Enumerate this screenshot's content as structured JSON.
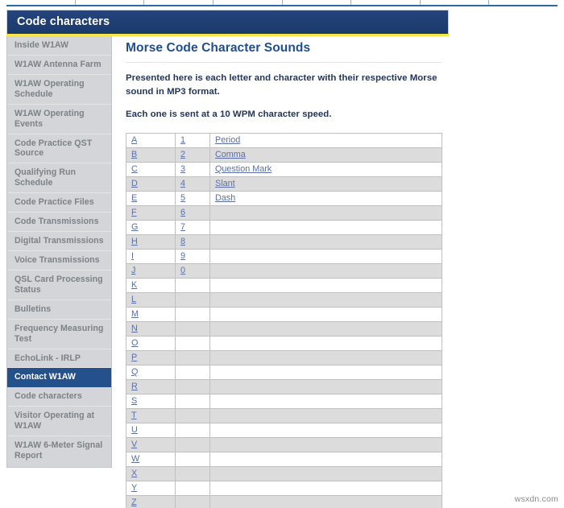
{
  "banner": {
    "title": "Code characters",
    "accent_color": "#1f3e73",
    "rule_color": "#f5e64a"
  },
  "sidebar": {
    "active_index": 14,
    "active_bg": "#24518c",
    "bg": "#d3d5d8",
    "items": [
      {
        "label": "Inside W1AW"
      },
      {
        "label": "W1AW Antenna Farm"
      },
      {
        "label": "W1AW Operating Schedule"
      },
      {
        "label": "W1AW Operating Events"
      },
      {
        "label": "Code Practice QST Source"
      },
      {
        "label": "Qualifying Run Schedule"
      },
      {
        "label": "Code Practice Files"
      },
      {
        "label": "Code Transmissions"
      },
      {
        "label": "Digital Transmissions"
      },
      {
        "label": "Voice Transmissions"
      },
      {
        "label": "QSL Card Processing Status"
      },
      {
        "label": "Bulletins"
      },
      {
        "label": "Frequency Measuring Test"
      },
      {
        "label": "EchoLink - IRLP"
      },
      {
        "label": "Contact W1AW"
      },
      {
        "label": "Code characters"
      },
      {
        "label": "Visitor Operating at W1AW"
      },
      {
        "label": "W1AW 6-Meter Signal Report"
      }
    ]
  },
  "main": {
    "title": "Morse Code Character Sounds",
    "paragraph_1": "Presented here is each letter and character with their respective Morse sound in MP3 format.",
    "paragraph_2": "Each one is sent at a 10 WPM character speed.",
    "link_color": "#5a6fa8",
    "table": {
      "rows": [
        {
          "letter": "A",
          "number": "1",
          "symbol": "Period"
        },
        {
          "letter": "B",
          "number": "2",
          "symbol": "Comma"
        },
        {
          "letter": "C",
          "number": "3",
          "symbol": "Question Mark"
        },
        {
          "letter": "D",
          "number": "4",
          "symbol": "Slant"
        },
        {
          "letter": "E",
          "number": "5",
          "symbol": "Dash"
        },
        {
          "letter": "F",
          "number": "6",
          "symbol": ""
        },
        {
          "letter": "G",
          "number": "7",
          "symbol": ""
        },
        {
          "letter": "H",
          "number": "8",
          "symbol": ""
        },
        {
          "letter": "I",
          "number": "9",
          "symbol": ""
        },
        {
          "letter": "J",
          "number": "0",
          "symbol": ""
        },
        {
          "letter": "K",
          "number": "",
          "symbol": ""
        },
        {
          "letter": "L",
          "number": "",
          "symbol": ""
        },
        {
          "letter": "M",
          "number": "",
          "symbol": ""
        },
        {
          "letter": "N",
          "number": "",
          "symbol": ""
        },
        {
          "letter": "O",
          "number": "",
          "symbol": ""
        },
        {
          "letter": "P",
          "number": "",
          "symbol": ""
        },
        {
          "letter": "Q",
          "number": "",
          "symbol": ""
        },
        {
          "letter": "R",
          "number": "",
          "symbol": ""
        },
        {
          "letter": "S",
          "number": "",
          "symbol": ""
        },
        {
          "letter": "T",
          "number": "",
          "symbol": ""
        },
        {
          "letter": "U",
          "number": "",
          "symbol": ""
        },
        {
          "letter": "V",
          "number": "",
          "symbol": ""
        },
        {
          "letter": "W",
          "number": "",
          "symbol": ""
        },
        {
          "letter": "X",
          "number": "",
          "symbol": ""
        },
        {
          "letter": "Y",
          "number": "",
          "symbol": ""
        },
        {
          "letter": "Z",
          "number": "",
          "symbol": ""
        }
      ]
    }
  },
  "watermark": {
    "text": "wsxdn.com"
  }
}
